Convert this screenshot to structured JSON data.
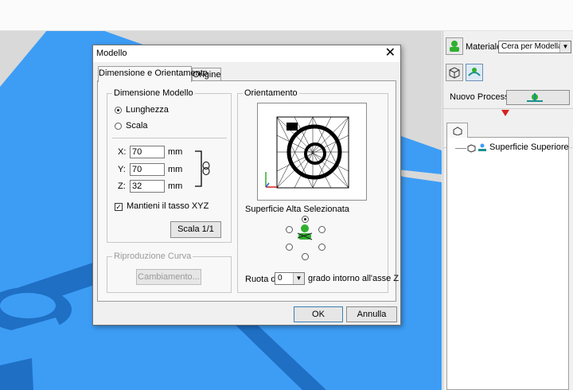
{
  "panel": {
    "material_label": "Materiale",
    "material_value": "Cera per Modellare",
    "new_process_label": "Nuovo Processo",
    "tree_item": "Superficie Superiore"
  },
  "dialog": {
    "title": "Modello",
    "tabs": [
      "Dimensione e Orientamento",
      "Origine"
    ],
    "size_group": {
      "title": "Dimensione Modello",
      "radio_length": "Lunghezza",
      "radio_scale": "Scala",
      "selected": "Lunghezza",
      "x_label": "X:",
      "x_value": "70",
      "y_label": "Y:",
      "y_value": "70",
      "z_label": "Z:",
      "z_value": "32",
      "unit": "mm",
      "keep_ratio_label": "Mantieni il tasso XYZ",
      "keep_ratio_checked": true,
      "scale_button": "Scala 1/1"
    },
    "curve_group": {
      "title": "Riproduzione Curva",
      "change_button": "Cambiamento..."
    },
    "orientation_group": {
      "title": "Orientamento",
      "surface_label": "Superficie Alta Selezionata",
      "rotate_label": "Ruota di",
      "rotate_value": "0",
      "rotate_suffix": "grado intorno all'asse Z"
    },
    "ok_button": "OK",
    "cancel_button": "Annulla"
  },
  "colors": {
    "model_blue": "#3d9df5",
    "model_dark": "#1f6fc4",
    "accent_green": "#2fb02f",
    "arrow_red": "#d62020"
  }
}
